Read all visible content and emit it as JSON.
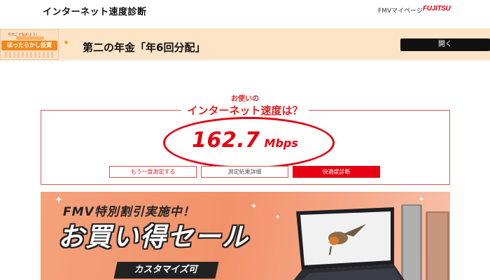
{
  "header": {
    "title": "インターネット速度診断",
    "fmv_link": "FMVマイページ",
    "brand": "FUJITSU"
  },
  "ad": {
    "thumb_top": "今日こそ始めよう!",
    "thumb_pill": "ほったらかし投資",
    "title": "第二の年金「年6回分配」",
    "open_button": "開く"
  },
  "result": {
    "question_small": "お使いの",
    "question_large": "インターネット速度は？",
    "speed_value": "162.7",
    "speed_unit": "Mbps",
    "buttons": {
      "retest": "もう一度測定する",
      "detail": "測定結果詳細",
      "tips": "快適度診断"
    }
  },
  "sale": {
    "subtitle": "FMV特別割引実施中！",
    "headline": "お買い得セール",
    "pill": "カスタマイズ可"
  },
  "colors": {
    "accent_red": "#e60012",
    "ad_orange": "#f0891d",
    "sale_orange": "#f2926a"
  }
}
